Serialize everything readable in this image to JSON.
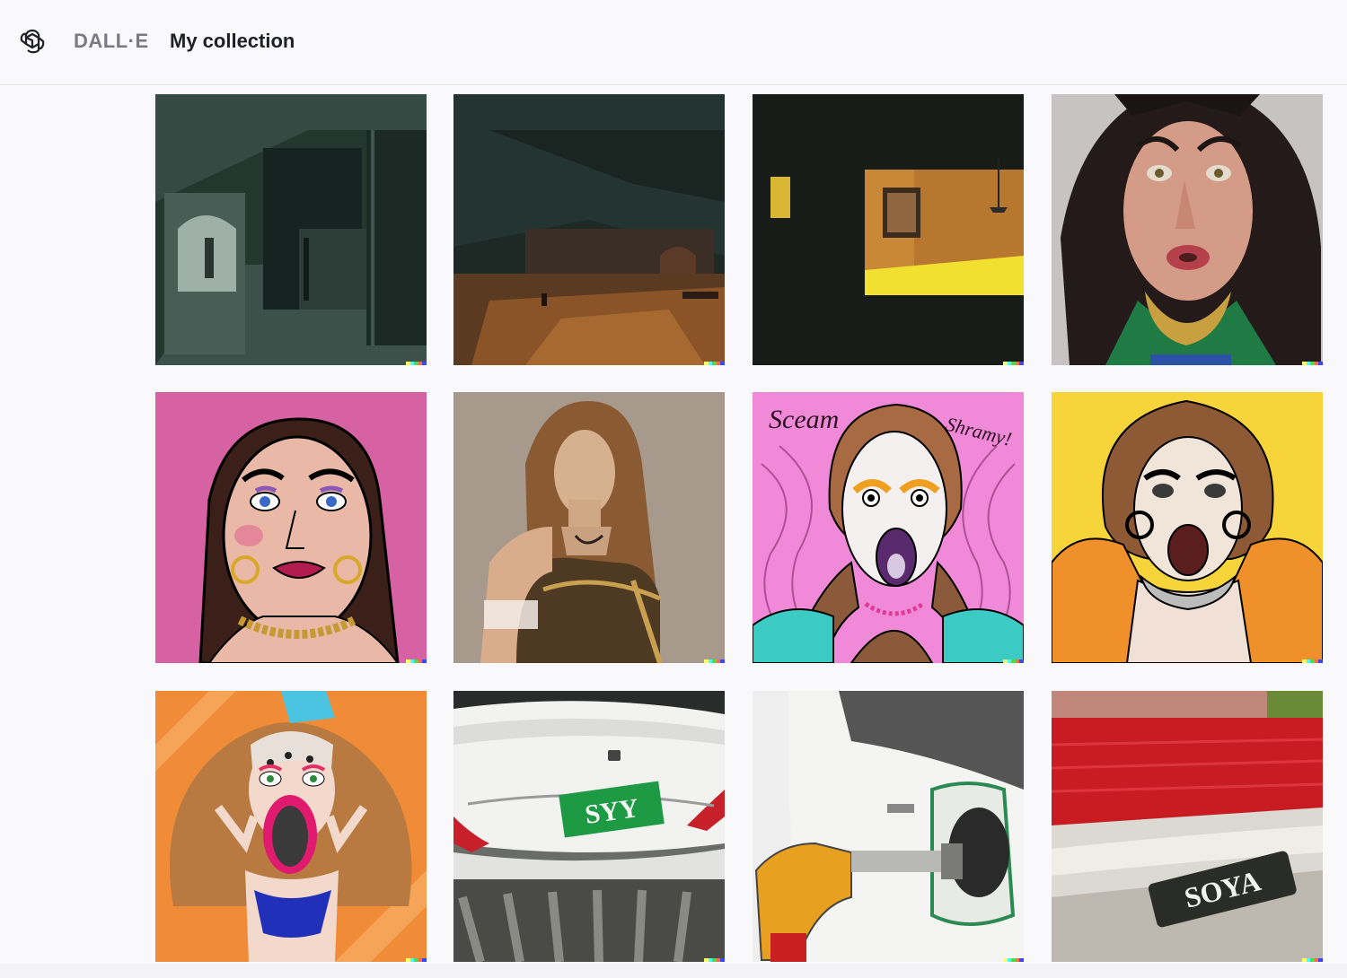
{
  "header": {
    "brand": "DALL·E",
    "breadcrumb": "My collection"
  },
  "icons": {
    "logo": "openai-logo-icon"
  },
  "watermark_colors": [
    "#ffff66",
    "#42ffff",
    "#51da4c",
    "#ff6e3c",
    "#3c46ff"
  ],
  "collection": {
    "images": [
      {
        "id": "tile-1",
        "subject": "dark-teal-interior-painting"
      },
      {
        "id": "tile-2",
        "subject": "dark-wooden-hall-painting"
      },
      {
        "id": "tile-3",
        "subject": "dark-room-with-yellow-window-painting"
      },
      {
        "id": "tile-4",
        "subject": "drag-queen-photo-green-gold"
      },
      {
        "id": "tile-5",
        "subject": "cartoon-drag-queen-pink-pattern"
      },
      {
        "id": "tile-6",
        "subject": "drag-portrait-long-brown-wig"
      },
      {
        "id": "tile-7",
        "subject": "screaming-drag-queen-pink-drawing"
      },
      {
        "id": "tile-8",
        "subject": "screaming-drag-queen-yellow-drawing"
      },
      {
        "id": "tile-9",
        "subject": "screaming-drag-collage-orange"
      },
      {
        "id": "tile-10",
        "subject": "white-car-rear-green-plate"
      },
      {
        "id": "tile-11",
        "subject": "car-refuelling-nozzle"
      },
      {
        "id": "tile-12",
        "subject": "car-tail-light-badge"
      }
    ],
    "plate_texts": {
      "tile-7": "Sceam ... Shramy!",
      "tile-10": "SYY",
      "tile-12": "SOYA"
    }
  }
}
